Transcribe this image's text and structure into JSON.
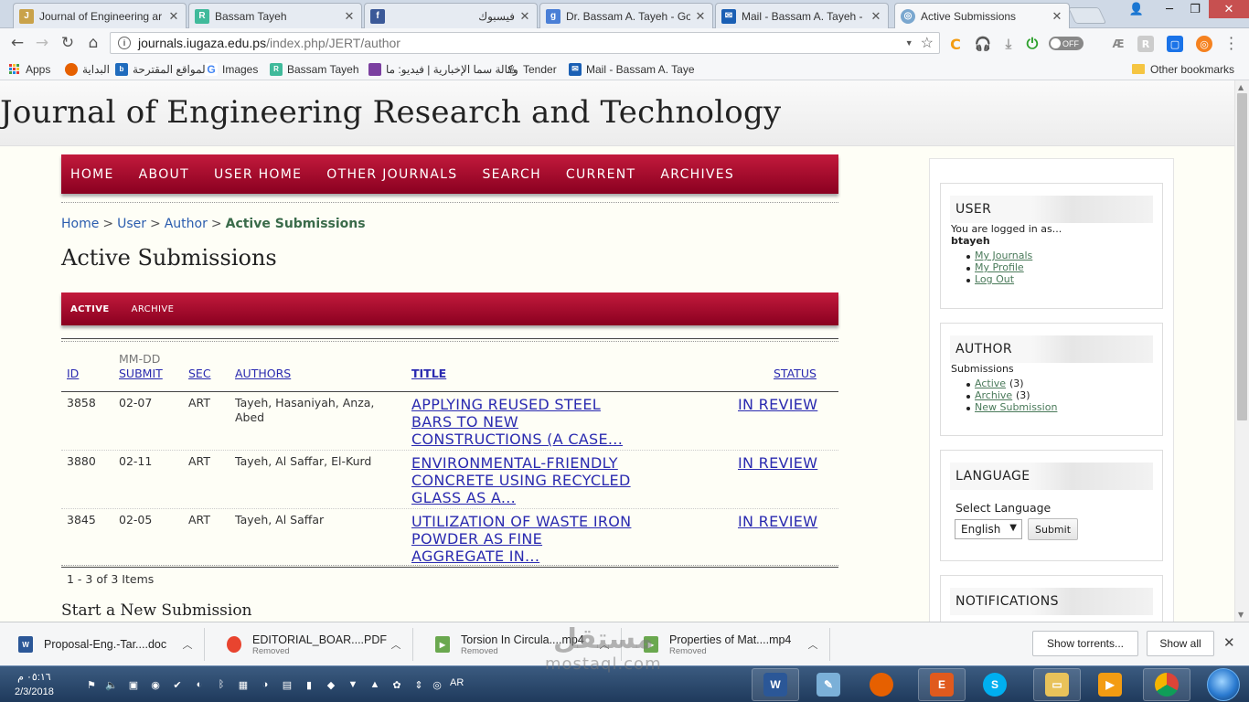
{
  "browser": {
    "tabs": [
      {
        "title": "Journal of Engineering ar",
        "icon": "journal-tab-icon",
        "color": "#c9a24a"
      },
      {
        "title": "Bassam Tayeh",
        "icon": "researchgate-icon",
        "color": "#40ba9b"
      },
      {
        "title": "فيسبوك",
        "icon": "facebook-icon",
        "color": "#3b5998"
      },
      {
        "title": "Dr. Bassam A. Tayeh - Go",
        "icon": "scholar-icon",
        "color": "#4a7fd6"
      },
      {
        "title": "Mail - Bassam A. Tayeh -",
        "icon": "mail-icon",
        "color": "#1a5fb4"
      },
      {
        "title": "Active Submissions",
        "icon": "ojs-icon",
        "color": "#7aa7cf"
      }
    ],
    "url_host": "journals.iugaza.edu.ps",
    "url_path": "/index.php/JERT/author",
    "toggle_label": "OFF",
    "bookmarks": [
      {
        "label": "Apps"
      },
      {
        "label": "البداية"
      },
      {
        "label": "المواقع المقترحة"
      },
      {
        "label": "Images"
      },
      {
        "label": "Bassam Tayeh"
      },
      {
        "label": "وكالة سما الإخبارية | فيديو: ما"
      },
      {
        "label": "Tender"
      },
      {
        "label": "Mail - Bassam A. Taye"
      }
    ],
    "other_bookmarks": "Other bookmarks"
  },
  "site": {
    "title": "Journal of Engineering Research and Technology",
    "nav": [
      "HOME",
      "ABOUT",
      "USER HOME",
      "OTHER JOURNALS",
      "SEARCH",
      "CURRENT",
      "ARCHIVES"
    ],
    "breadcrumb": {
      "home": "Home",
      "user": "User",
      "author": "Author",
      "current": "Active Submissions",
      "sep": ">"
    },
    "page_title": "Active Submissions",
    "subnav": {
      "active": "ACTIVE",
      "archive": "ARCHIVE"
    }
  },
  "table": {
    "headers": {
      "id": "ID",
      "submit_top": "MM-DD",
      "submit": "SUBMIT",
      "sec": "SEC",
      "authors": "AUTHORS",
      "title": "TITLE",
      "status": "STATUS"
    },
    "rows": [
      {
        "id": "3858",
        "submit": "02-07",
        "sec": "ART",
        "authors": "Tayeh, Hasaniyah, Anza, Abed",
        "title_l1": "APPLYING REUSED STEEL",
        "title_l2": "BARS TO NEW",
        "title_l3": "CONSTRUCTIONS (A CASE...",
        "status": "IN REVIEW"
      },
      {
        "id": "3880",
        "submit": "02-11",
        "sec": "ART",
        "authors": "Tayeh, Al Saffar, El-Kurd",
        "title_l1": "ENVIRONMENTAL-FRIENDLY",
        "title_l2": "CONCRETE USING RECYCLED",
        "title_l3": "GLASS AS A...",
        "status": "IN REVIEW"
      },
      {
        "id": "3845",
        "submit": "02-05",
        "sec": "ART",
        "authors": "Tayeh, Al Saffar",
        "title_l1": "UTILIZATION OF WASTE IRON",
        "title_l2": "POWDER AS FINE",
        "title_l3": "AGGREGATE IN...",
        "status": "IN REVIEW"
      }
    ],
    "items_count": "1 - 3 of 3 Items"
  },
  "start_new": "Start a New Submission",
  "sidebar": {
    "user": {
      "head": "USER",
      "logged_as": "You are logged in as...",
      "username": "btayeh",
      "links": [
        "My Journals",
        "My Profile",
        "Log Out"
      ]
    },
    "author": {
      "head": "AUTHOR",
      "submissions": "Submissions",
      "active": "Active",
      "active_count": "(3)",
      "archive": "Archive",
      "archive_count": "(3)",
      "new": "New Submission"
    },
    "language": {
      "head": "LANGUAGE",
      "label": "Select Language",
      "selected": "English",
      "submit": "Submit"
    },
    "notifications": {
      "head": "NOTIFICATIONS"
    }
  },
  "downloads": {
    "items": [
      {
        "name": "Proposal-Eng.-Tar....doc",
        "status": "",
        "color": "#2b5797"
      },
      {
        "name": "EDITORIAL_BOAR....PDF",
        "status": "Removed",
        "color": "#e8442f"
      },
      {
        "name": "Torsion In Circula....mp4",
        "status": "Removed",
        "color": "#6aa84f"
      },
      {
        "name": "Properties of Mat....mp4",
        "status": "Removed",
        "color": "#6aa84f"
      }
    ],
    "show_torrents": "Show torrents...",
    "show_all": "Show all"
  },
  "taskbar": {
    "time": "٠٥:١٦ م",
    "date": "2/3/2018",
    "lang": "AR"
  },
  "watermark": {
    "ar": "مستقل",
    "en": "mostaql.com"
  }
}
